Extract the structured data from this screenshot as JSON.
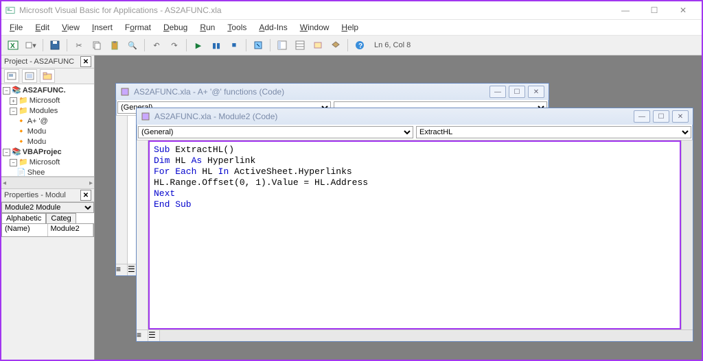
{
  "app_title": "Microsoft Visual Basic for Applications - AS2AFUNC.xla",
  "menus": [
    "File",
    "Edit",
    "View",
    "Insert",
    "Format",
    "Debug",
    "Run",
    "Tools",
    "Add-Ins",
    "Window",
    "Help"
  ],
  "cursor_pos": "Ln 6, Col 8",
  "project_panel_title": "Project - AS2AFUNC",
  "properties_panel_title": "Properties - Modul",
  "props_object": "Module2",
  "props_object_type": "Module",
  "props_tab_alpha": "Alphabetic",
  "props_tab_cat": "Categ",
  "props_name_label": "(Name)",
  "props_name_value": "Module2",
  "tree": {
    "root1": "AS2AFUNC.",
    "ms1": "Microsoft",
    "modules": "Modules",
    "m1": "A+ '@",
    "m2": "Modu",
    "m3": "Modu",
    "root2": "VBAProjec",
    "ms2": "Microsoft",
    "sheet": "Shee"
  },
  "win1": {
    "title": "AS2AFUNC.xla - A+ '@' functions (Code)",
    "left_sel": "(General)"
  },
  "win2": {
    "title": "AS2AFUNC.xla - Module2 (Code)",
    "left_sel": "(General)",
    "right_sel": "ExtractHL",
    "code_html": "<span class='kw'>Sub</span> ExtractHL()\n<span class='kw'>Dim</span> HL <span class='kw'>As</span> Hyperlink\n<span class='kw'>For Each</span> HL <span class='kw'>In</span> ActiveSheet.Hyperlinks\nHL.Range.Offset(0, 1).Value = HL.Address\n<span class='kw'>Next</span>\n<span class='kw'>End Sub</span>"
  }
}
